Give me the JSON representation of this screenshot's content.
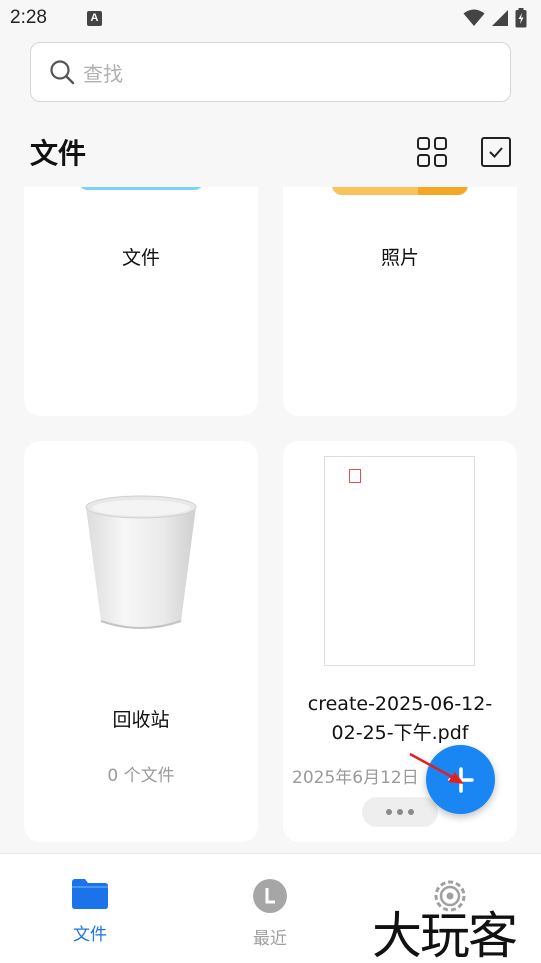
{
  "status_bar": {
    "time": "2:28",
    "notification_icon": "A"
  },
  "search": {
    "placeholder": "查找"
  },
  "header": {
    "title": "文件"
  },
  "cards": [
    {
      "label": "文件",
      "icon": "folder-image",
      "accent_color": "#7dd3f5"
    },
    {
      "label": "照片",
      "icon": "photo-folder-image",
      "accent_color": "#f9b233"
    },
    {
      "label": "回收站",
      "sublabel": "0 个文件",
      "icon": "trash-bin-icon"
    },
    {
      "label": "create-2025-06-12-02-25-下午.pdf",
      "sublabel": "2025年6月12日",
      "icon": "pdf-thumbnail"
    }
  ],
  "fab": {
    "icon": "plus-icon",
    "color": "#1a86f3"
  },
  "bottom_nav": {
    "items": [
      {
        "label": "文件",
        "icon": "folder-icon",
        "active": true
      },
      {
        "label": "最近",
        "icon": "recent-icon",
        "active": false
      },
      {
        "label": "设置",
        "icon": "settings-icon",
        "active": false
      }
    ],
    "active_color": "#1a73e8",
    "inactive_color": "#a0a0a0"
  },
  "watermark": "大玩客"
}
